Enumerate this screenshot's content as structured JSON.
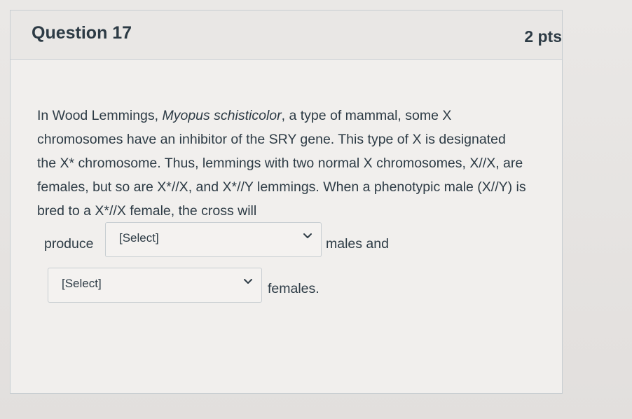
{
  "question": {
    "title": "Question 17",
    "points": "2 pts",
    "text_part1": "In Wood Lemmings, ",
    "species": "Myopus schisticolor",
    "text_part2": ", a type of mammal, some X chromosomes have an inhibitor of the SRY gene. This type of X is designated the X* chromosome. Thus, lemmings with two normal X chromosomes, X//X, are females, but so are X*//X, and X*//Y lemmings. When a phenotypic male (X//Y) is bred to a X*//X female, the cross will",
    "produce_word": "produce",
    "males_and": "males and",
    "females": "females."
  },
  "dropdowns": {
    "males": {
      "selected": "[Select]",
      "icon": "chevron-down-icon"
    },
    "females": {
      "selected": "[Select]",
      "icon": "chevron-down-icon"
    }
  },
  "colors": {
    "text": "#2d3b45",
    "border": "#c7cdd1",
    "card_background": "#f1efed"
  }
}
